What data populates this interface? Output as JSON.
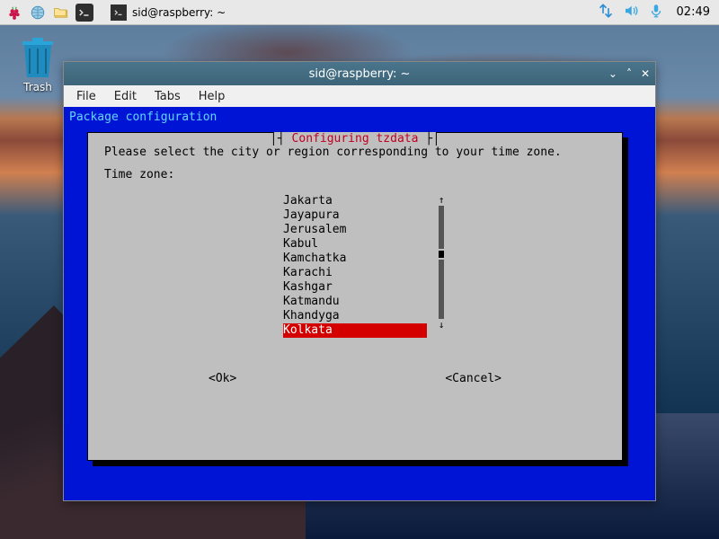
{
  "taskbar": {
    "task_label": "sid@raspberry: ~",
    "clock": "02:49"
  },
  "desktop": {
    "trash_label": "Trash"
  },
  "window": {
    "title": "sid@raspberry: ~",
    "menu": {
      "file": "File",
      "edit": "Edit",
      "tabs": "Tabs",
      "help": "Help"
    }
  },
  "terminal": {
    "header_line": "Package configuration",
    "dialog_title": "Configuring tzdata",
    "prompt": "Please select the city or region corresponding to your time zone.",
    "field_label": "Time zone:",
    "options": [
      "Jakarta",
      "Jayapura",
      "Jerusalem",
      "Kabul",
      "Kamchatka",
      "Karachi",
      "Kashgar",
      "Katmandu",
      "Khandyga",
      "Kolkata"
    ],
    "selected_index": 9,
    "ok_label": "<Ok>",
    "cancel_label": "<Cancel>"
  }
}
